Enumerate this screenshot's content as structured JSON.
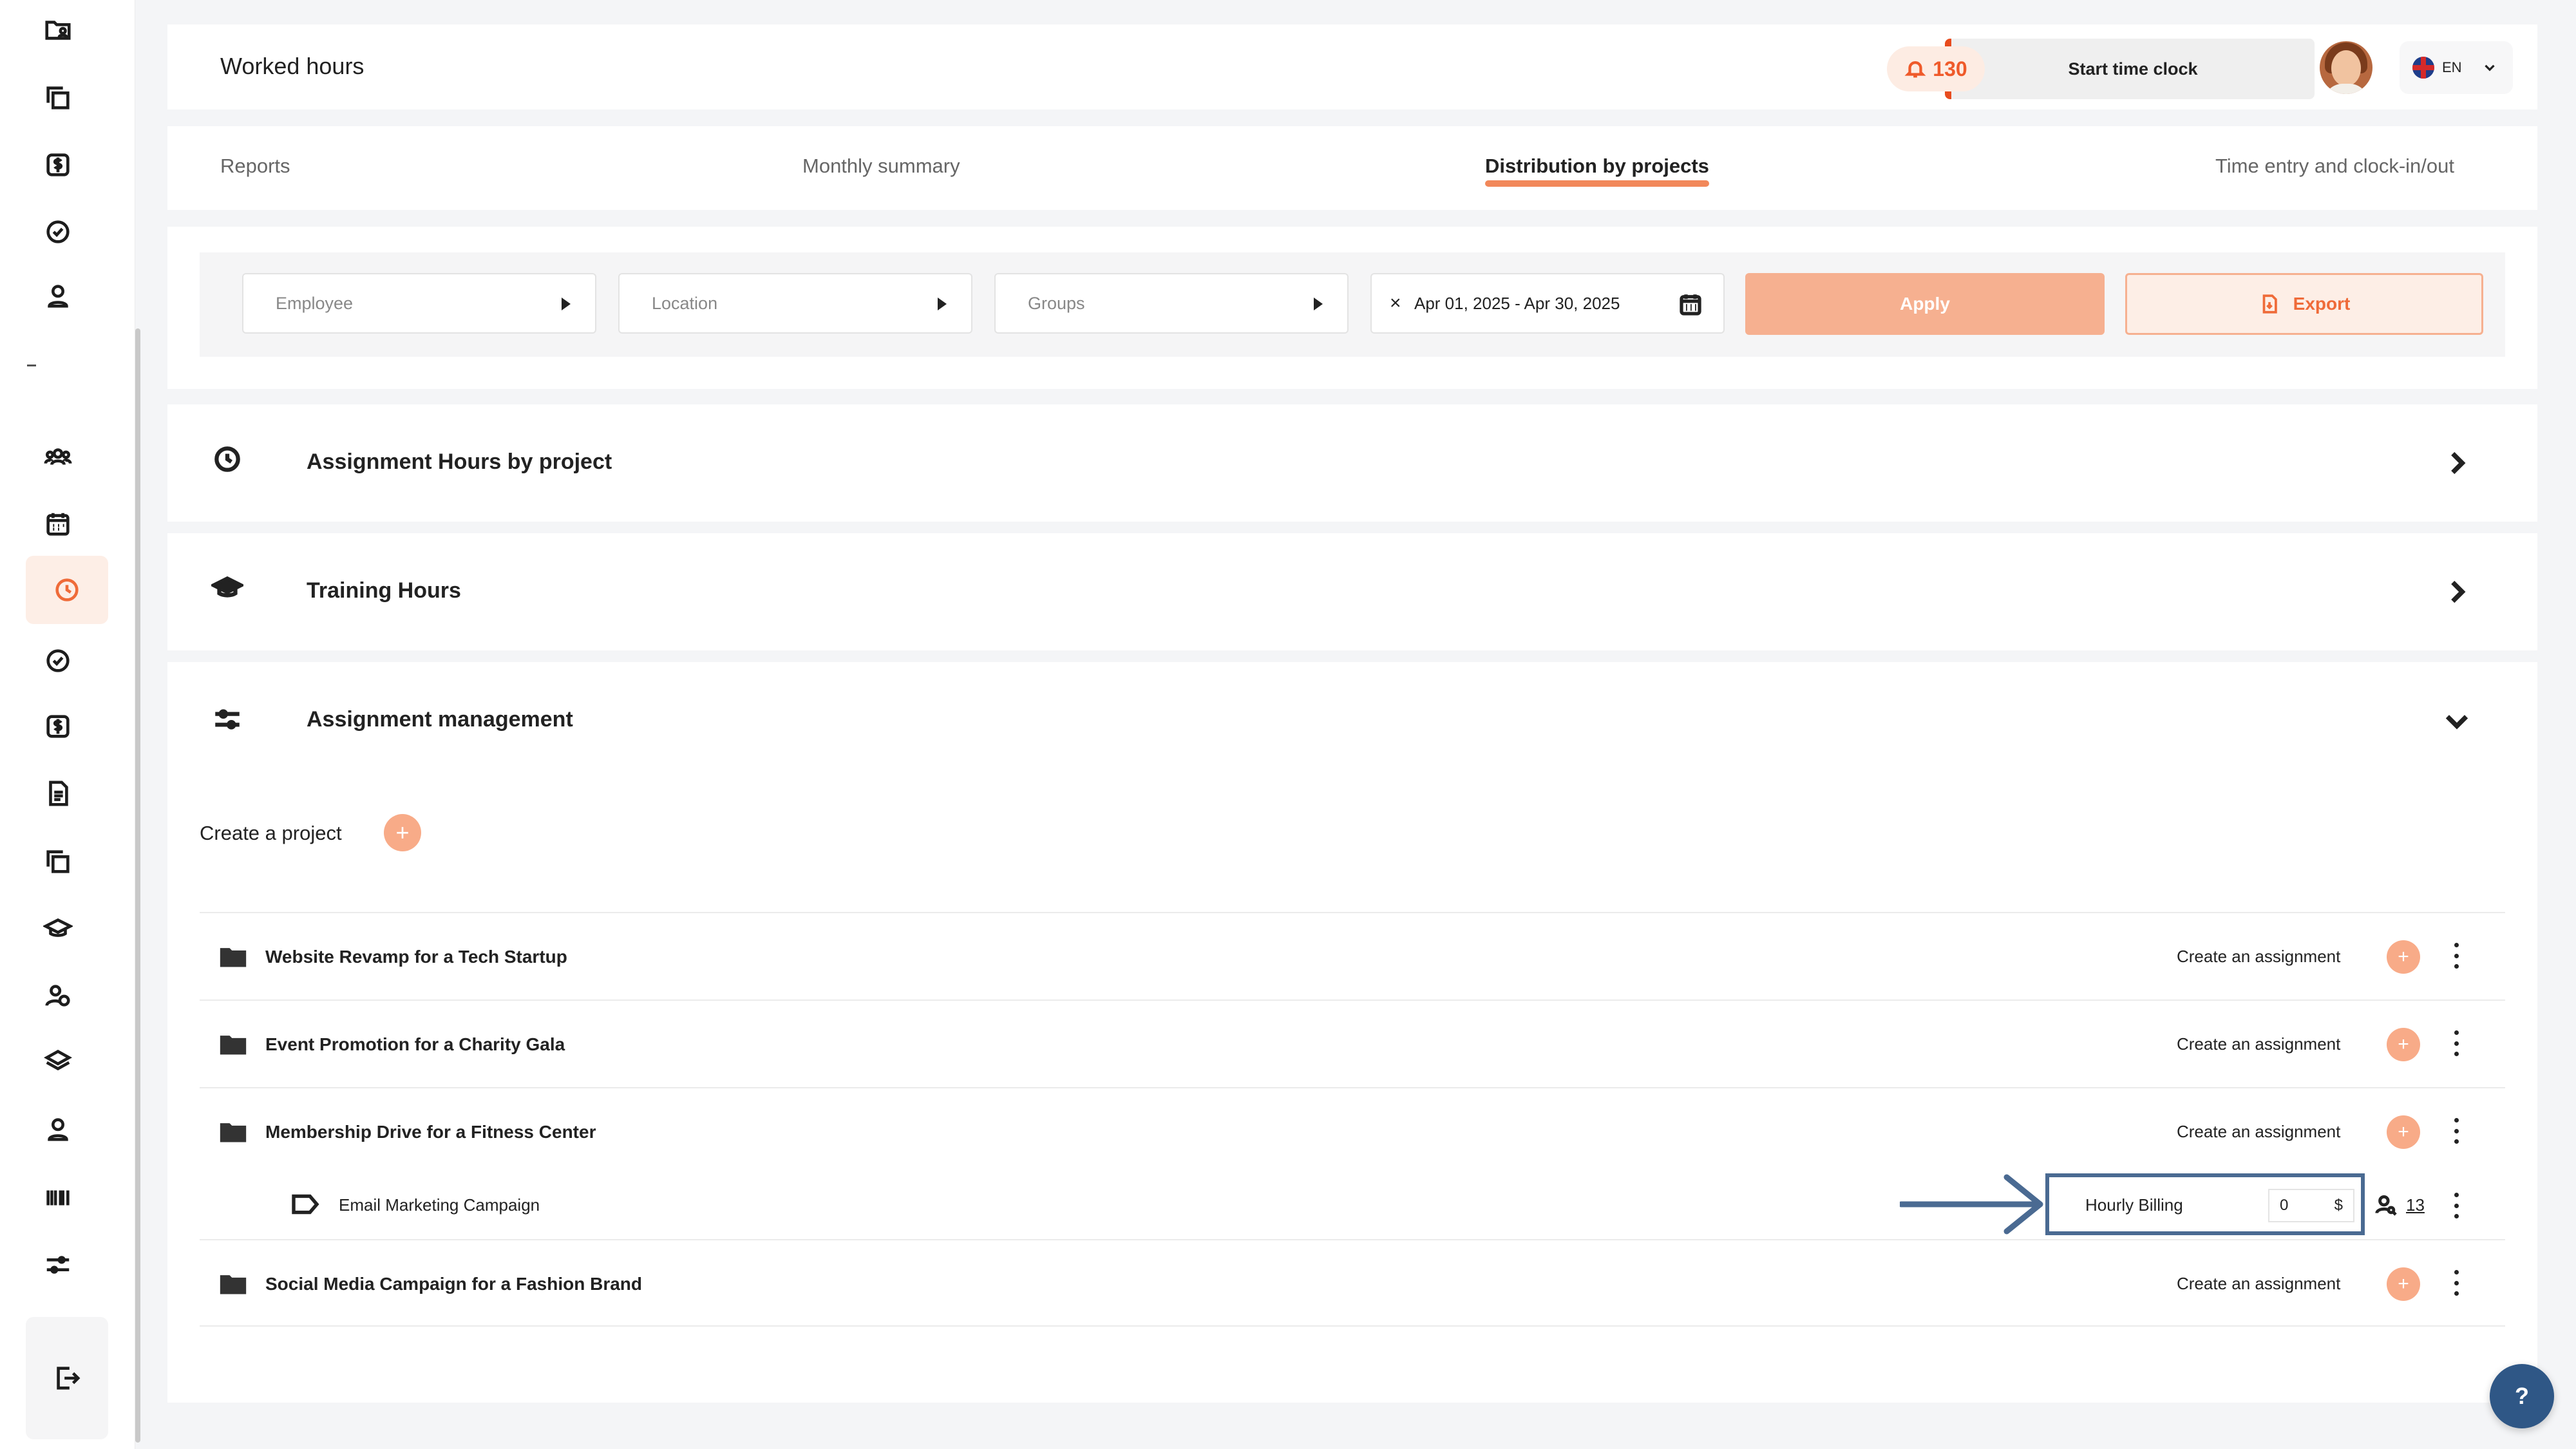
{
  "header": {
    "title": "Worked hours",
    "start_clock_label": "Start time clock",
    "notification_count": "130",
    "language": "EN"
  },
  "tabs": [
    {
      "label": "Reports"
    },
    {
      "label": "Monthly summary"
    },
    {
      "label": "Distribution by projects"
    },
    {
      "label": "Time entry and clock-in/out"
    }
  ],
  "filters": {
    "employee_placeholder": "Employee",
    "location_placeholder": "Location",
    "groups_placeholder": "Groups",
    "date_range": "Apr 01, 2025 - Apr 30, 2025",
    "apply_label": "Apply",
    "export_label": "Export"
  },
  "sections": {
    "assignment_hours": "Assignment Hours by project",
    "training_hours": "Training Hours",
    "assignment_management": "Assignment management"
  },
  "management": {
    "create_project_label": "Create a project",
    "create_assignment_label": "Create an assignment",
    "projects": [
      {
        "name": "Website Revamp for a Tech Startup"
      },
      {
        "name": "Event Promotion for a Charity Gala"
      },
      {
        "name": "Membership Drive for a Fitness Center"
      },
      {
        "name": "Social Media Campaign for a Fashion Brand"
      }
    ],
    "assignment": {
      "name": "Email Marketing Campaign",
      "billing_label": "Hourly Billing",
      "billing_value": "0",
      "currency": "$",
      "user_count": "13"
    }
  },
  "help_label": "?",
  "colors": {
    "accent": "#ef6b39",
    "accent_light": "#f8ab88",
    "highlight_box": "#4a6a92",
    "help_button": "#2f5786"
  }
}
